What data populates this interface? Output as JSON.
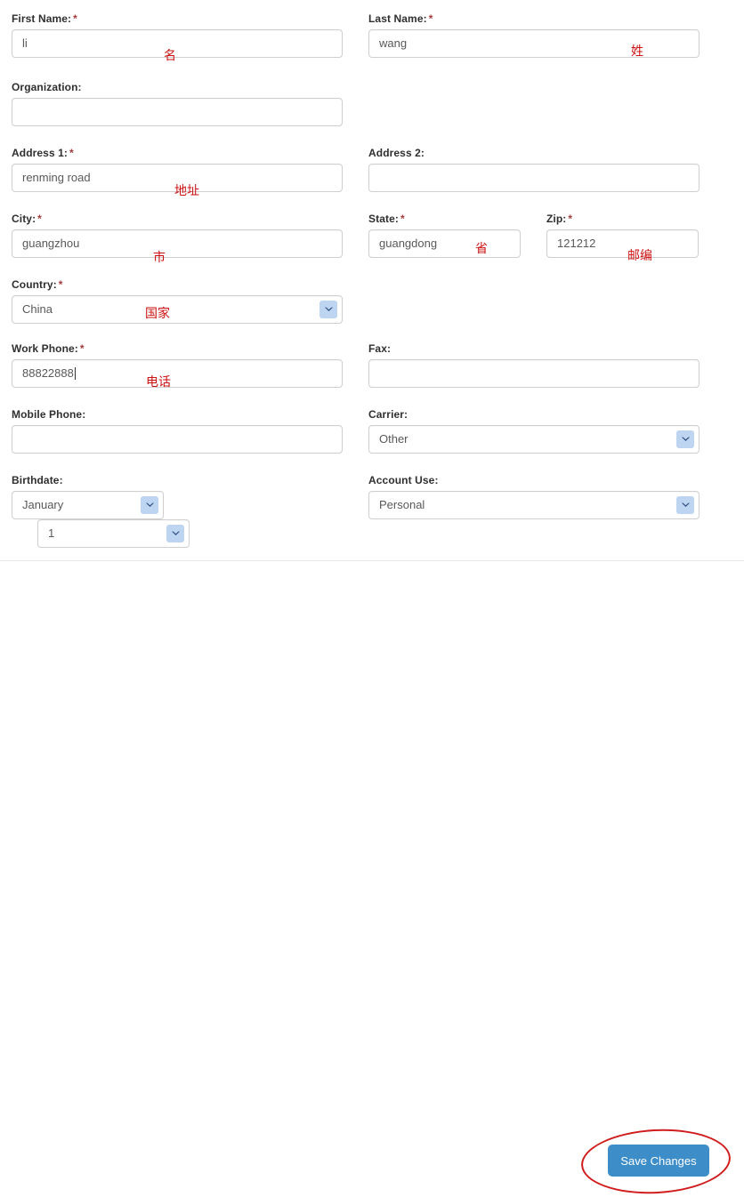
{
  "form": {
    "fields": [
      {
        "key": "first_name",
        "label": "First Name:",
        "required": true,
        "value": "li",
        "annotation": "名",
        "type": "text"
      },
      {
        "key": "last_name",
        "label": "Last Name:",
        "required": true,
        "value": "wang",
        "annotation": "姓",
        "type": "text"
      },
      {
        "key": "organization",
        "label": "Organization:",
        "required": false,
        "value": "",
        "annotation": "",
        "type": "text"
      },
      {
        "key": "address1",
        "label": "Address 1:",
        "required": true,
        "value": "renming road",
        "annotation": "地址",
        "type": "text"
      },
      {
        "key": "address2",
        "label": "Address 2:",
        "required": false,
        "value": "",
        "annotation": "",
        "type": "text"
      },
      {
        "key": "city",
        "label": "City:",
        "required": true,
        "value": "guangzhou",
        "annotation": "市",
        "type": "text"
      },
      {
        "key": "state",
        "label": "State:",
        "required": true,
        "value": "guangdong",
        "annotation": "省",
        "type": "text"
      },
      {
        "key": "zip",
        "label": "Zip:",
        "required": true,
        "value": "121212",
        "annotation": "邮编",
        "type": "text"
      },
      {
        "key": "country",
        "label": "Country:",
        "required": true,
        "value": "China",
        "annotation": "国家",
        "type": "select"
      },
      {
        "key": "work_phone",
        "label": "Work Phone:",
        "required": true,
        "value": "88822888",
        "annotation": "电话",
        "type": "text",
        "focused": true
      },
      {
        "key": "fax",
        "label": "Fax:",
        "required": false,
        "value": "",
        "annotation": "",
        "type": "text"
      },
      {
        "key": "mobile_phone",
        "label": "Mobile Phone:",
        "required": false,
        "value": "",
        "annotation": "",
        "type": "text"
      },
      {
        "key": "carrier",
        "label": "Carrier:",
        "required": false,
        "value": "Other",
        "annotation": "",
        "type": "select"
      },
      {
        "key": "birthdate",
        "label": "Birthdate:",
        "required": false,
        "annotation": "",
        "type": "select-pair",
        "month_value": "January",
        "day_value": "1"
      },
      {
        "key": "account_use",
        "label": "Account Use:",
        "required": false,
        "value": "Personal",
        "annotation": "",
        "type": "select"
      }
    ]
  },
  "footer": {
    "save_label": "Save Changes"
  },
  "icons": {
    "dropdown": "chevron-down-icon",
    "highlight": "ellipse-highlight-annotation"
  },
  "colors": {
    "accent_button": "#3d8dc8",
    "annotation_red": "#cc1111",
    "required_star": "#a33b3b",
    "label_text": "#2f2f2f",
    "input_text": "#595959",
    "input_border": "#cfcfcf",
    "select_arrow_bg": "#bed5f2",
    "highlight_stroke": "#d01d1d",
    "divider": "#e6e6e6"
  }
}
